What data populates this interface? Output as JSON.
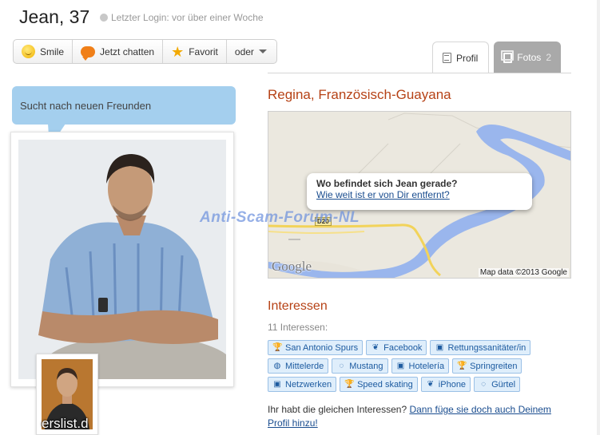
{
  "header": {
    "name": "Jean, 37",
    "last_login": "Letzter Login: vor über einer Woche"
  },
  "actions": {
    "smile": "Smile",
    "chat": "Jetzt chatten",
    "favorite": "Favorit",
    "more": "oder"
  },
  "tabs": {
    "profile": "Profil",
    "photos": "Fotos",
    "photos_count": "2"
  },
  "status_bubble": "Sucht nach neuen Freunden",
  "thumbnail_caption": "erslist.d",
  "location": "Regina, Französisch-Guayana",
  "map": {
    "popup_title": "Wo befindet sich Jean gerade?",
    "popup_link": "Wie weit ist er von Dir entfernt?",
    "logo": "Google",
    "attribution": "Map data ©2013 Google",
    "road_label": "D20"
  },
  "watermark": "Anti-Scam-Forum-NL",
  "interests": {
    "title": "Interessen",
    "count": "11 Interessen:",
    "rows": [
      [
        {
          "label": "San Antonio Spurs",
          "icon": "trophy-icon"
        },
        {
          "label": "Facebook",
          "icon": "leaf-icon"
        },
        {
          "label": "Rettungssanitäter/in",
          "icon": "briefcase-icon"
        }
      ],
      [
        {
          "label": "Mittelerde",
          "icon": "globe-icon"
        },
        {
          "label": "Mustang",
          "icon": "ring-icon"
        },
        {
          "label": "Hotelería",
          "icon": "briefcase-icon"
        },
        {
          "label": "Springreiten",
          "icon": "trophy-icon"
        }
      ],
      [
        {
          "label": "Netzwerken",
          "icon": "briefcase-icon"
        },
        {
          "label": "Speed skating",
          "icon": "trophy-icon"
        },
        {
          "label": "iPhone",
          "icon": "leaf-icon"
        },
        {
          "label": "Gürtel",
          "icon": "ring-icon"
        }
      ]
    ]
  },
  "bottom": {
    "question": "Ihr habt die gleichen Interessen?",
    "link": "Dann füge sie doch auch Deinem Profil hinzu!"
  }
}
